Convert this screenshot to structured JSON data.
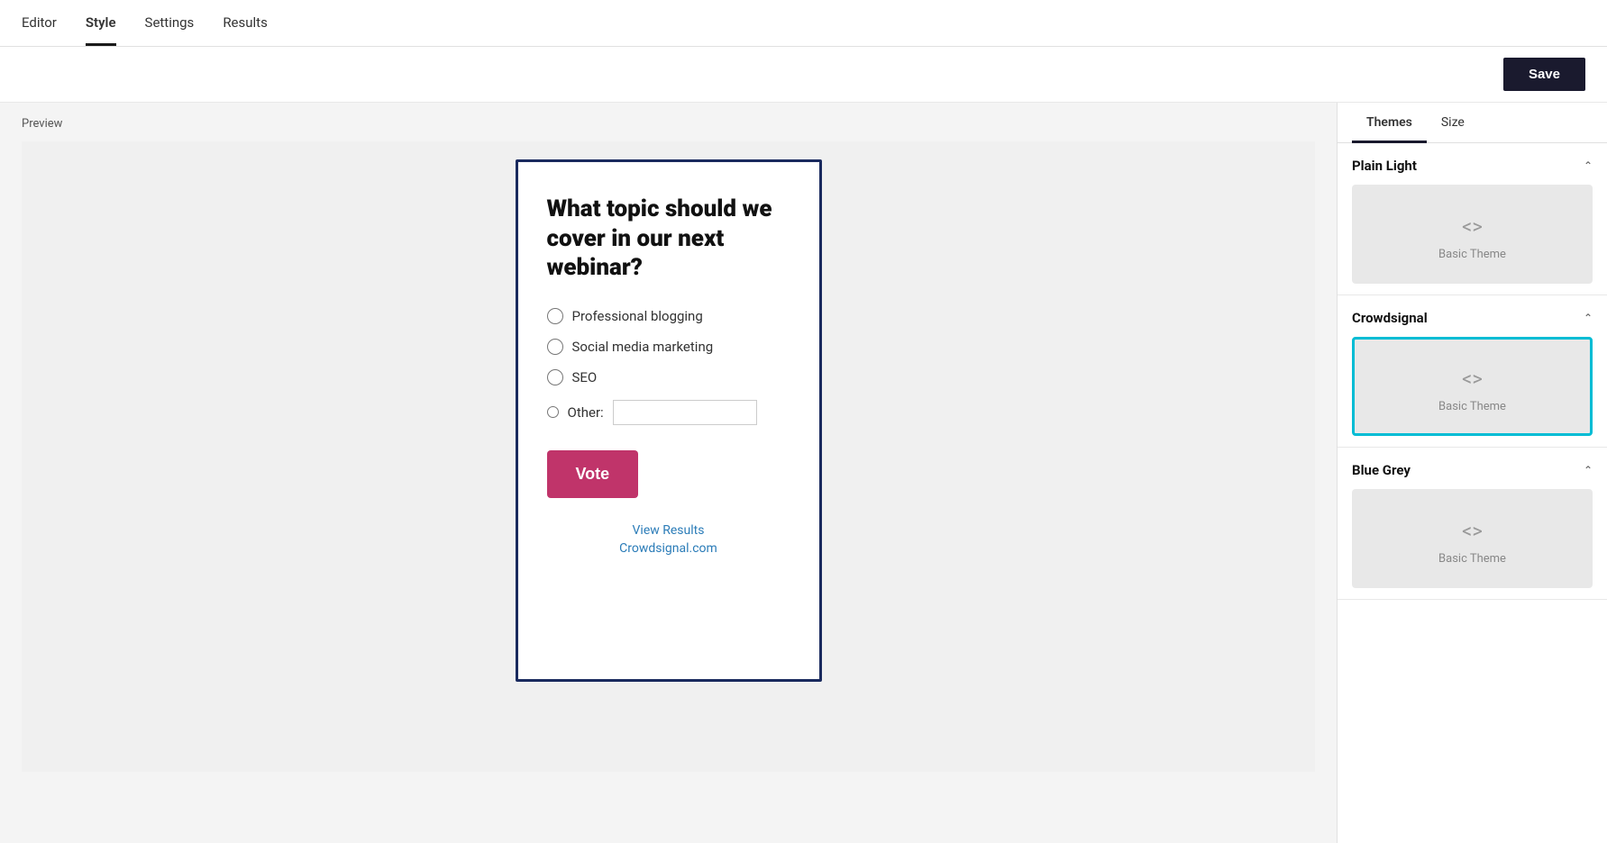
{
  "nav": {
    "items": [
      {
        "id": "editor",
        "label": "Editor",
        "active": false
      },
      {
        "id": "style",
        "label": "Style",
        "active": true
      },
      {
        "id": "settings",
        "label": "Settings",
        "active": false
      },
      {
        "id": "results",
        "label": "Results",
        "active": false
      }
    ]
  },
  "toolbar": {
    "save_label": "Save"
  },
  "preview": {
    "label": "Preview"
  },
  "poll": {
    "question": "What topic should we cover in our next webinar?",
    "options": [
      {
        "id": "opt1",
        "label": "Professional blogging"
      },
      {
        "id": "opt2",
        "label": "Social media marketing"
      },
      {
        "id": "opt3",
        "label": "SEO"
      },
      {
        "id": "opt4",
        "label": "Other:",
        "has_input": true
      }
    ],
    "vote_button": "Vote",
    "view_results": "View Results",
    "crowdsignal_link": "Crowdsignal.com"
  },
  "sidebar": {
    "tabs": [
      {
        "id": "themes",
        "label": "Themes",
        "active": true
      },
      {
        "id": "size",
        "label": "Size",
        "active": false
      }
    ],
    "theme_sections": [
      {
        "id": "plain-light",
        "title": "Plain Light",
        "expanded": true,
        "card": {
          "label": "Basic Theme",
          "icon": "<>",
          "selected": false
        }
      },
      {
        "id": "crowdsignal",
        "title": "Crowdsignal",
        "expanded": true,
        "card": {
          "label": "Basic Theme",
          "icon": "<>",
          "selected": true
        }
      },
      {
        "id": "blue-grey",
        "title": "Blue Grey",
        "expanded": true,
        "card": {
          "label": "Basic Theme",
          "icon": "<>",
          "selected": false
        }
      }
    ]
  }
}
